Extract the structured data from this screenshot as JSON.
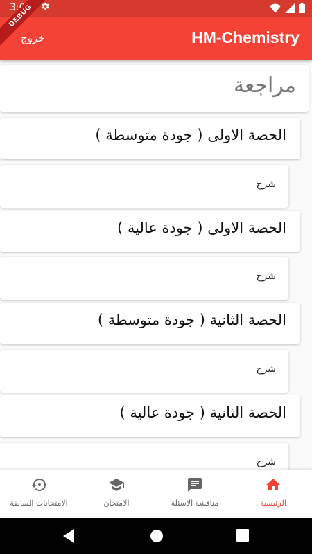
{
  "status_bar": {
    "time": "3:01"
  },
  "debug_banner": "DEBUG",
  "app_bar": {
    "title": "HM-Chemistry",
    "logout_label": "خروج"
  },
  "review": {
    "title": "مراجعة"
  },
  "lessons": [
    {
      "title": "الحصة الاولى ( جودة متوسطة )",
      "explain_label": "شرح"
    },
    {
      "title": "الحصة الاولى ( جودة عالية )",
      "explain_label": "شرح"
    },
    {
      "title": "الحصة الثانية ( جودة متوسطة )",
      "explain_label": "شرح"
    },
    {
      "title": "الحصة الثانية ( جودة عالية )",
      "explain_label": "شرح"
    }
  ],
  "bottom_nav": {
    "items": [
      {
        "label": "الامتحانات السابقة",
        "icon": "history-icon",
        "active": false
      },
      {
        "label": "الامتحان",
        "icon": "school-icon",
        "active": false
      },
      {
        "label": "مناقشة الاسئلة",
        "icon": "chat-icon",
        "active": false
      },
      {
        "label": "الرئيسية",
        "icon": "home-icon",
        "active": true
      }
    ]
  },
  "colors": {
    "primary": "#f44336",
    "status_bar": "#d63a2f",
    "inactive_icon": "#666666"
  }
}
